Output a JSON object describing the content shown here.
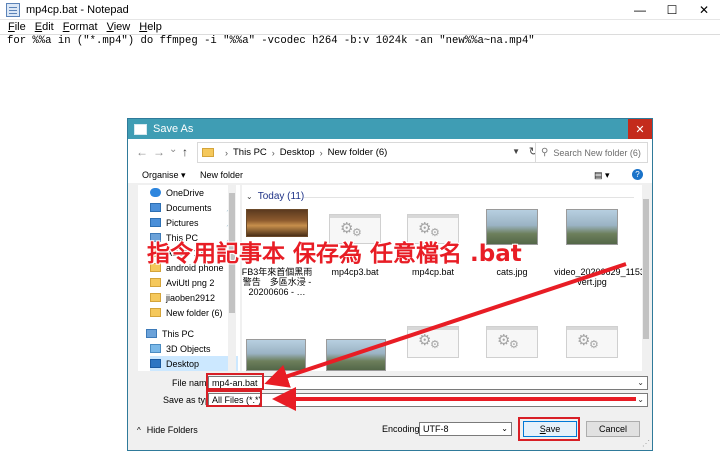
{
  "notepad": {
    "title": "mp4cp.bat - Notepad",
    "menu": [
      "File",
      "Edit",
      "Format",
      "View",
      "Help"
    ],
    "content": "for %%a in (\"*.mp4\") do ffmpeg -i \"%%a\" -vcodec h264 -b:v 1024k -an \"new%%a~na.mp4\"",
    "window_controls": {
      "minimize": "—",
      "maximize": "☐",
      "close": "✕"
    }
  },
  "dialog": {
    "title": "Save As",
    "close_glyph": "✕",
    "nav": {
      "back": "←",
      "forward": "→",
      "down": "⌄",
      "up": "↑"
    },
    "breadcrumb": [
      "This PC",
      "Desktop",
      "New folder (6)"
    ],
    "breadcrumb_sep": "›",
    "search_placeholder": "Search New folder (6)",
    "toolbar": {
      "organise": "Organise ▾",
      "new_folder": "New folder",
      "view_glyph": "▤ ▾",
      "help_glyph": "?"
    },
    "navpane": [
      {
        "label": "OneDrive",
        "icon": "cloud-icon",
        "pinned": false
      },
      {
        "label": "Documents",
        "icon": "documents-icon",
        "pinned": true
      },
      {
        "label": "Pictures",
        "icon": "pictures-icon",
        "pinned": true
      },
      {
        "label": "This PC",
        "icon": "pc-icon",
        "pinned": true
      },
      {
        "label": "ADBC 12",
        "icon": "folder-icon",
        "pinned": false
      },
      {
        "label": "android phone",
        "icon": "folder-icon",
        "pinned": false
      },
      {
        "label": "AviUtl png 2",
        "icon": "folder-icon",
        "pinned": false
      },
      {
        "label": "jiaoben2912",
        "icon": "folder-icon",
        "pinned": false
      },
      {
        "label": "New folder (6)",
        "icon": "folder-icon",
        "pinned": false
      },
      {
        "label": "This PC",
        "icon": "pc-icon",
        "pinned": false
      },
      {
        "label": "3D Objects",
        "icon": "3d-objects-icon",
        "pinned": false
      },
      {
        "label": "Desktop",
        "icon": "desktop-icon",
        "pinned": false
      }
    ],
    "group_header": "Today (11)",
    "files_row1": [
      {
        "name": "FB3年來首個黑雨警告　多區水浸 - 20200606 - …",
        "type": "video"
      },
      {
        "name": "mp4cp3.bat",
        "type": "bat"
      },
      {
        "name": "mp4cp.bat",
        "type": "bat"
      },
      {
        "name": "cats.jpg",
        "type": "photo"
      },
      {
        "name": "video_20200629_115326-vert.jpg",
        "type": "photo"
      }
    ],
    "files_row2": [
      {
        "name": "",
        "type": "photo"
      },
      {
        "name": "",
        "type": "photo"
      },
      {
        "name": "",
        "type": "bat"
      },
      {
        "name": "",
        "type": "bat"
      },
      {
        "name": "",
        "type": "bat"
      }
    ],
    "file_name_label": "File name:",
    "file_name_value": "mp4-an.bat",
    "save_type_label": "Save as type:",
    "save_type_value": "All Files  (*.*)",
    "hide_folders": "Hide Folders",
    "encoding_label": "Encoding:",
    "encoding_value": "UTF-8",
    "save_button": "Save",
    "cancel_button": "Cancel"
  },
  "annotation": {
    "text": "指令用記事本  保存為  任意檔名 .bat",
    "color": "#e81d25"
  }
}
